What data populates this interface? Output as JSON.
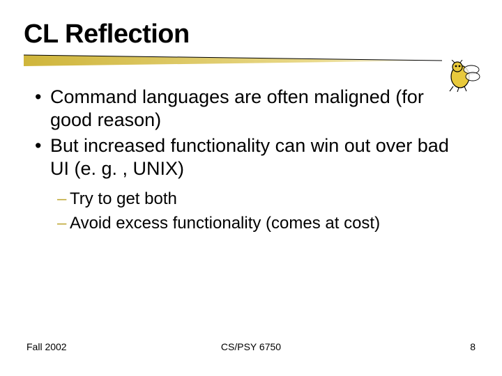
{
  "title": "CL Reflection",
  "bullets": [
    "Command languages are often maligned (for good reason)",
    "But increased functionality can win out over bad UI (e. g. , UNIX)"
  ],
  "sub_bullets": [
    "Try to get both",
    "Avoid excess functionality (comes at cost)"
  ],
  "footer": {
    "left": "Fall 2002",
    "center": "CS/PSY 6750",
    "right": "8"
  },
  "logo_name": "georgia-tech-yellow-jacket"
}
